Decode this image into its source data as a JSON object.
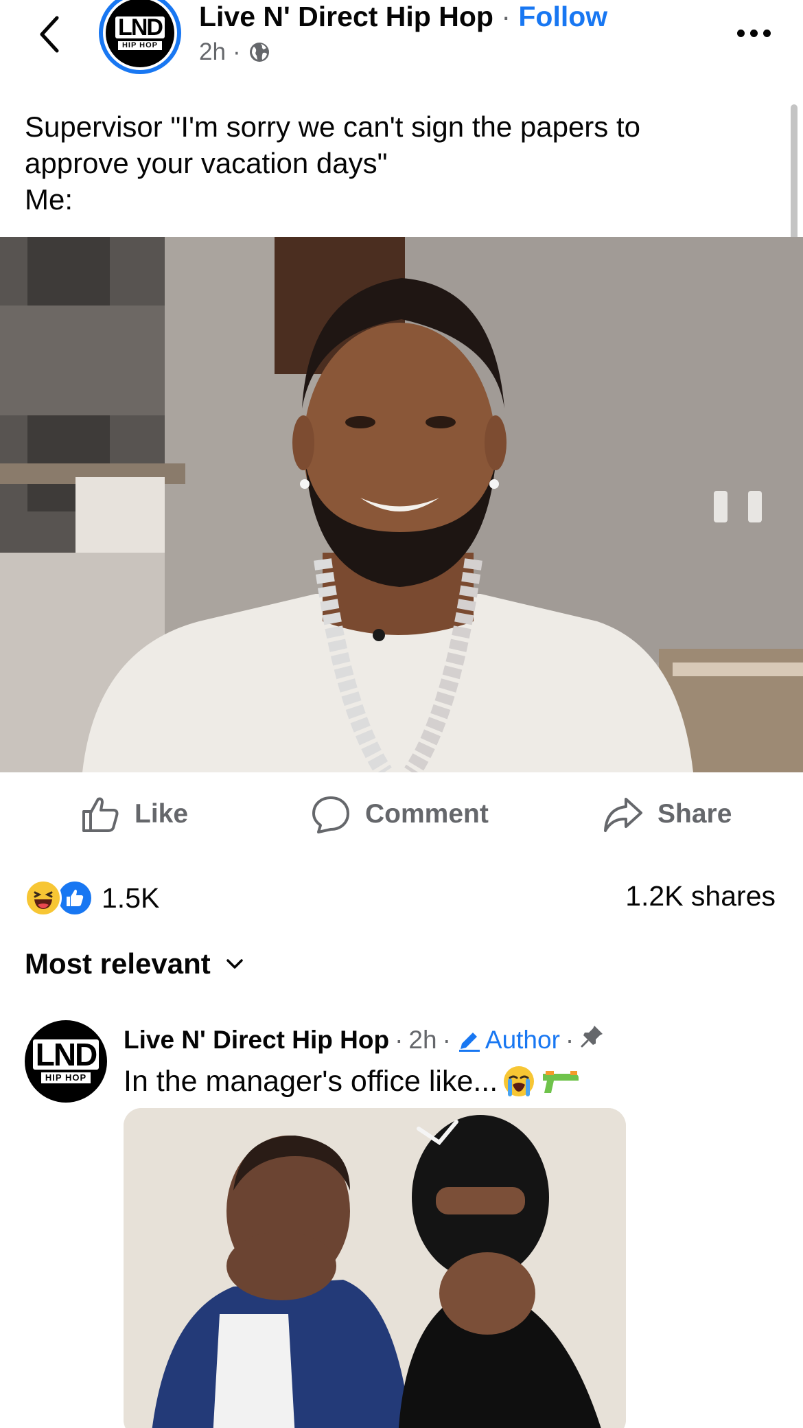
{
  "header": {
    "page_name": "Live N' Direct Hip Hop",
    "separator": "·",
    "follow_label": "Follow",
    "time": "2h",
    "meta_separator": "·",
    "privacy_icon": "globe-icon",
    "back_icon": "chevron-left-icon",
    "more_icon": "more-dots-icon"
  },
  "logo": {
    "text": "LND",
    "subtext": "HIP HOP"
  },
  "post": {
    "caption_lines": [
      "Supervisor \"I'm sorry we can't sign the papers to",
      "approve your vacation days\"",
      "Me:"
    ]
  },
  "actions": {
    "like_label": "Like",
    "comment_label": "Comment",
    "share_label": "Share"
  },
  "stats": {
    "reaction_icons": [
      "haha-icon",
      "like-reaction-icon"
    ],
    "reaction_count": "1.5K",
    "shares": "1.2K shares"
  },
  "comments": {
    "sort_label": "Most relevant",
    "items": [
      {
        "author": "Live N' Direct Hip Hop",
        "time": "2h",
        "badge": "Author",
        "text": "In the manager's office like...",
        "emojis": [
          "crying-face-emoji",
          "water-pistol-emoji"
        ]
      }
    ]
  },
  "colors": {
    "accent": "#1877f2",
    "text": "#050505",
    "secondary": "#65676b"
  }
}
